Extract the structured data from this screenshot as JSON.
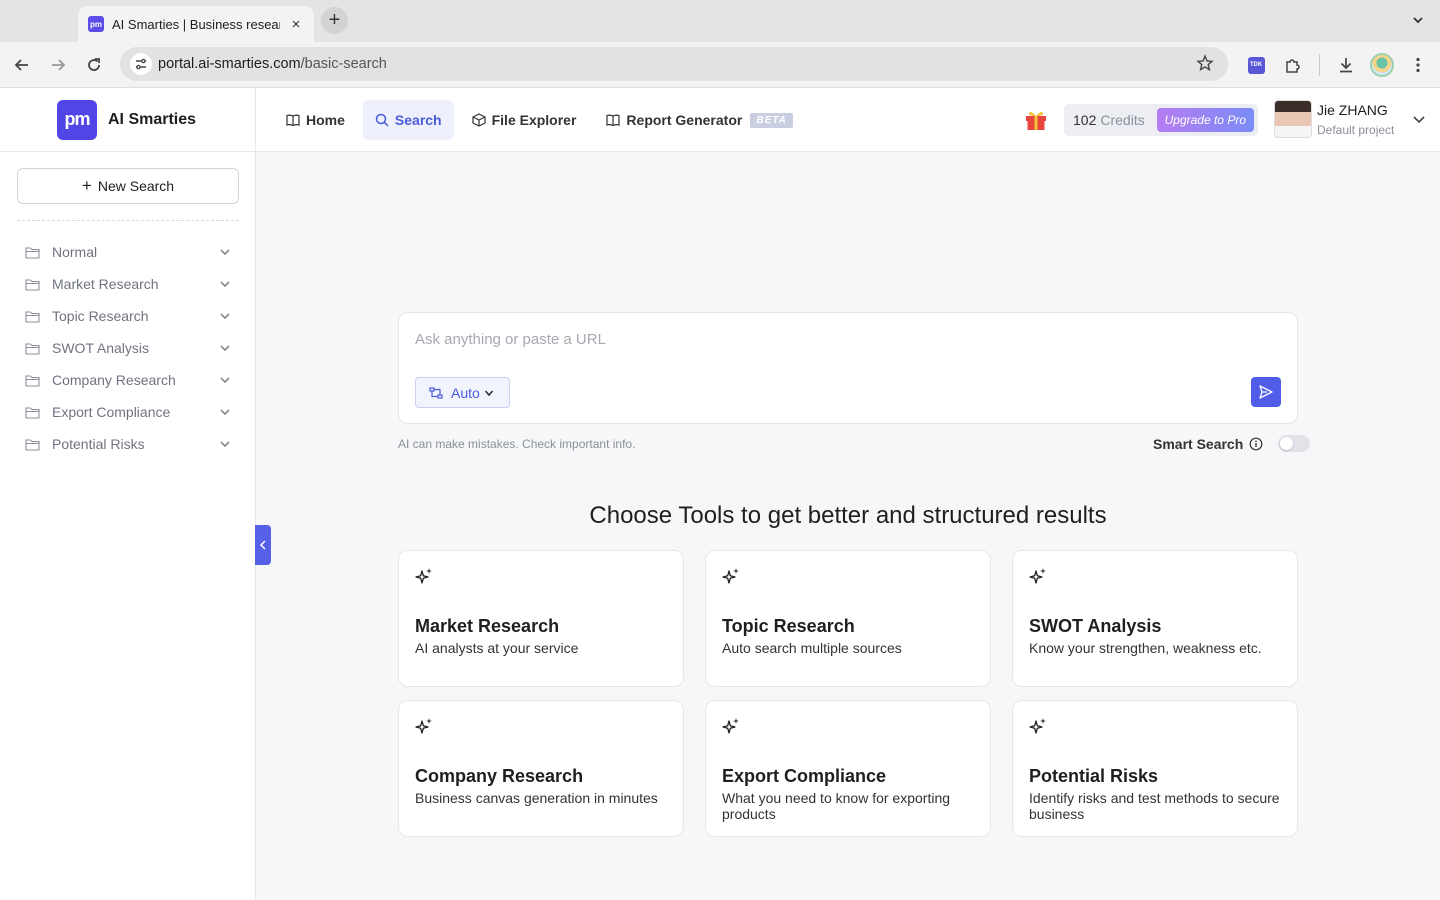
{
  "browser": {
    "tab_title": "AI Smarties | Business research",
    "tab_favicon": "pm",
    "url_domain": "portal.ai-smarties.com",
    "url_path": "/basic-search",
    "extension_label": "TDK"
  },
  "brand": {
    "logo_text": "pm",
    "name": "AI Smarties",
    "color": "#5146e5"
  },
  "topnav": [
    {
      "label": "Home",
      "icon": "book-icon"
    },
    {
      "label": "Search",
      "icon": "search-icon",
      "active": true
    },
    {
      "label": "File Explorer",
      "icon": "cube-icon"
    },
    {
      "label": "Report Generator",
      "icon": "book-open-icon",
      "badge": "BETA"
    }
  ],
  "header": {
    "credits_value": "102",
    "credits_label": "Credits",
    "upgrade_label": "Upgrade to Pro",
    "user_name": "Jie ZHANG",
    "user_project": "Default project"
  },
  "sidebar": {
    "new_search_label": "New Search",
    "folders": [
      {
        "label": "Normal"
      },
      {
        "label": "Market Research"
      },
      {
        "label": "Topic Research"
      },
      {
        "label": "SWOT Analysis"
      },
      {
        "label": "Company Research"
      },
      {
        "label": "Export Compliance"
      },
      {
        "label": "Potential Risks"
      }
    ]
  },
  "search": {
    "placeholder": "Ask anything or paste a URL",
    "mode_label": "Auto",
    "disclaimer": "AI can make mistakes. Check important info.",
    "smart_search_label": "Smart Search",
    "smart_search_enabled": false
  },
  "tools": {
    "heading": "Choose Tools to get better and structured results",
    "cards": [
      {
        "title": "Market Research",
        "desc": "AI analysts at your service"
      },
      {
        "title": "Topic Research",
        "desc": "Auto search multiple sources"
      },
      {
        "title": "SWOT Analysis",
        "desc": "Know your strengthen, weakness etc."
      },
      {
        "title": "Company Research",
        "desc": "Business canvas generation in minutes"
      },
      {
        "title": "Export Compliance",
        "desc": "What you need to know for exporting products"
      },
      {
        "title": "Potential Risks",
        "desc": "Identify risks and test methods to secure business"
      }
    ]
  },
  "colors": {
    "accent": "#4f5de8",
    "active_nav_bg": "#eef1fb"
  }
}
